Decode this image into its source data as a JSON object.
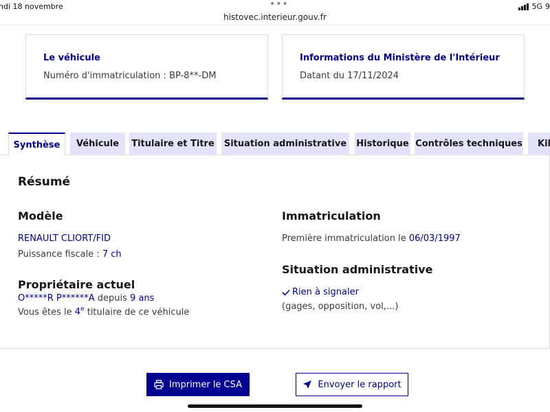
{
  "status_bar": {
    "date": "ndi 18 novembre",
    "dots": "•••",
    "network": "5G",
    "extra": "9"
  },
  "browser": {
    "url": "histovec.interieur.gouv.fr"
  },
  "cards": {
    "vehicle": {
      "title": "Le véhicule",
      "label": "Numéro d'immatriculation : BP-8**-DM"
    },
    "ministry": {
      "title": "Informations du Ministère de l'Intérieur",
      "label": "Datant du 17/11/2024"
    }
  },
  "tabs": [
    {
      "label": "Synthèse"
    },
    {
      "label": "Véhicule"
    },
    {
      "label": "Titulaire et Titre"
    },
    {
      "label": "Situation administrative"
    },
    {
      "label": "Historique"
    },
    {
      "label": "Contrôles techniques"
    },
    {
      "label": "Kilo"
    }
  ],
  "summary": {
    "heading": "Résumé",
    "model": {
      "heading": "Modèle",
      "name": "RENAULT CLIORT/FID",
      "power_label": "Puissance fiscale :",
      "power_value": "7 ch"
    },
    "owner": {
      "heading": "Propriétaire actuel",
      "name": "O*****R P******A",
      "since_word": "depuis",
      "since_value": "9 ans",
      "rank_prefix": "Vous êtes le",
      "rank_number": "4",
      "rank_sup": "e",
      "rank_suffix": "titulaire de ce véhicule"
    },
    "registration": {
      "heading": "Immatriculation",
      "first_label": "Première immatriculation le",
      "first_date": "06/03/1997"
    },
    "admin": {
      "heading": "Situation administrative",
      "status": "Rien à signaler",
      "detail": "(gages, opposition, vol,...)"
    }
  },
  "actions": {
    "print": "Imprimer le CSA",
    "send": "Envoyer le rapport"
  },
  "colors": {
    "primary": "#000091",
    "tab_bg": "#e3e3fd"
  }
}
